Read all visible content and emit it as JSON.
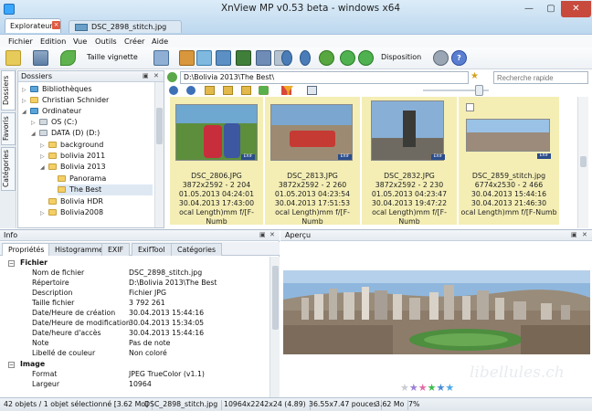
{
  "window": {
    "title": "XnView MP v0.53 beta - windows x64",
    "tabs": [
      {
        "label": "Explorateur"
      },
      {
        "label": "DSC_2898_stitch.jpg"
      }
    ],
    "close_label": "✕",
    "min_label": "—",
    "max_label": "▢"
  },
  "menu": [
    "Fichier",
    "Edition",
    "Vue",
    "Outils",
    "Créer",
    "Aide"
  ],
  "toolbar": {
    "taille_vignette": "Taille vignette",
    "disposition": "Disposition"
  },
  "address": {
    "path": "D:\\Bolivia 2013\\The Best\\",
    "search_placeholder": "Recherche rapide"
  },
  "left_tabs": [
    "Dossiers",
    "Favoris",
    "Catégories"
  ],
  "folders": {
    "title": "Dossiers",
    "items": [
      {
        "label": "Bibliothèques"
      },
      {
        "label": "Christian Schnider"
      },
      {
        "label": "Ordinateur"
      },
      {
        "label": "OS (C:)"
      },
      {
        "label": "DATA (D) (D:)"
      },
      {
        "label": "background"
      },
      {
        "label": "bolivia 2011"
      },
      {
        "label": "Bolivia 2013"
      },
      {
        "label": "Panorama"
      },
      {
        "label": "The Best"
      },
      {
        "label": "Bolivia HDR"
      },
      {
        "label": "Bolivia2008"
      }
    ]
  },
  "thumbnails": [
    {
      "name": "DSC_2806.JPG",
      "dims": "3872x2592 - 2 204",
      "date1": "01.05.2013 04:24:01",
      "date2": "30.04.2013 17:43:00",
      "exif": "ocal Length)mm f/[F-Numb",
      "badge": "EXIF"
    },
    {
      "name": "DSC_2813.JPG",
      "dims": "3872x2592 - 2 260",
      "date1": "01.05.2013 04:23:54",
      "date2": "30.04.2013 17:51:53",
      "exif": "ocal Length)mm f/[F-Numb",
      "badge": "EXIF"
    },
    {
      "name": "DSC_2832.JPG",
      "dims": "3872x2592 - 2 230",
      "date1": "01.05.2013 04:23:47",
      "date2": "30.04.2013 19:47:22",
      "exif": "ocal Length)mm f/[F-Numb",
      "badge": "EXIF"
    },
    {
      "name": "DSC_2859_stitch.jpg",
      "dims": "6774x2530 - 2 466",
      "date1": "30.04.2013 15:44:16",
      "date2": "30.04.2013 21:46:30",
      "exif": "ocal Length)mm f/[F-Numb",
      "badge": "EXIF"
    }
  ],
  "info": {
    "title": "Info",
    "tabs": [
      "Propriétés",
      "Histogramme",
      "EXIF",
      "ExifTool",
      "Catégories"
    ],
    "sections": [
      {
        "section": "Fichier"
      },
      {
        "key": "Nom de fichier",
        "value": "DSC_2898_stitch.jpg"
      },
      {
        "key": "Répertoire",
        "value": "D:\\Bolivia 2013\\The Best"
      },
      {
        "key": "Description",
        "value": "Fichier JPG"
      },
      {
        "key": "Taille fichier",
        "value": "3 792 261"
      },
      {
        "key": "Date/Heure de création",
        "value": "30.04.2013 15:44:16"
      },
      {
        "key": "Date/Heure de modification",
        "value": "30.04.2013 15:34:05"
      },
      {
        "key": "Date/heure d'accès",
        "value": "30.04.2013 15:44:16"
      },
      {
        "key": "Note",
        "value": "Pas de note"
      },
      {
        "key": "Libellé de couleur",
        "value": "Non coloré"
      },
      {
        "section": "Image"
      },
      {
        "key": "Format",
        "value": "JPEG TrueColor (v1.1)"
      },
      {
        "key": "Largeur",
        "value": "10964"
      }
    ]
  },
  "preview": {
    "title": "Aperçu",
    "watermark": "libellules.ch",
    "star_colors": [
      "#c9ccd2",
      "#9b7fd4",
      "#e16ba6",
      "#3dbb4d",
      "#4a8ad8",
      "#4fa8e6"
    ]
  },
  "status": {
    "count": "42 objets / 1 objet sélectionné [3.62 Mo]",
    "file": "DSC_2898_stitch.jpg",
    "dims": "10964x2242x24 (4.89)",
    "size_in": "36.55x7.47 pouces",
    "size_mb": "3.62 Mo",
    "zoom": "7%"
  },
  "colors": {
    "selection": "#f4eeb5",
    "accent": "#3aa7ff",
    "close": "#c74a3d"
  }
}
